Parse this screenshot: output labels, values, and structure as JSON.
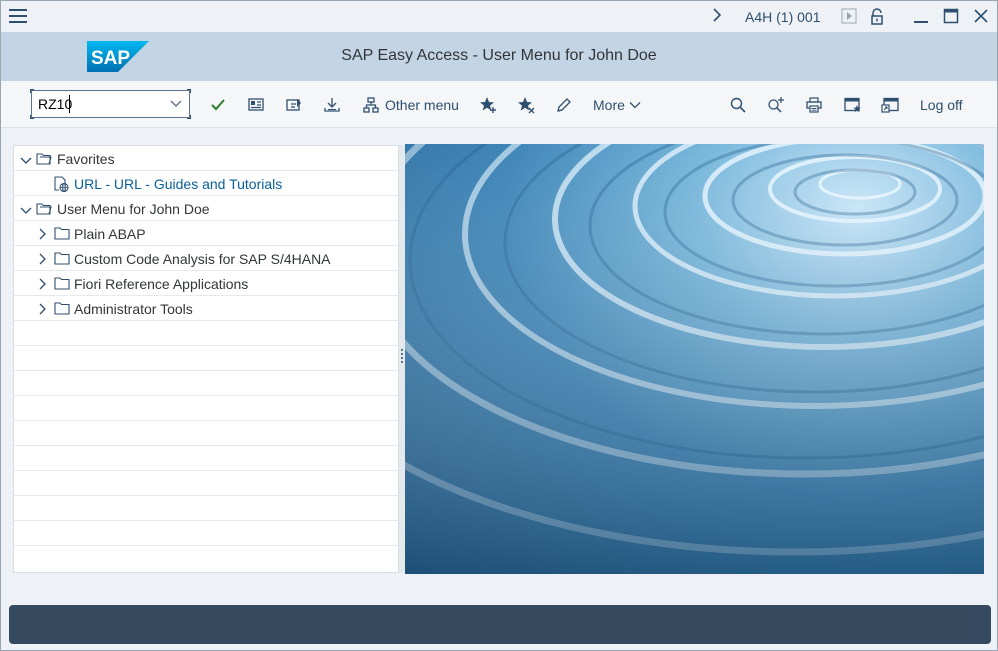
{
  "topbar": {
    "menu_icon": "hamburger-icon",
    "system_info": "A4H (1) 001",
    "icons": [
      "chevron-right-icon",
      "play-icon",
      "unlock-icon",
      "minimize-icon",
      "maximize-icon",
      "close-icon"
    ]
  },
  "header": {
    "logo_text": "SAP",
    "title": "SAP Easy Access  -  User Menu for John Doe",
    "brand_color": "#008fd3"
  },
  "toolbar": {
    "command_field": {
      "value": "RZ10"
    },
    "buttons": {
      "enter": "checkmark-icon",
      "other_menu": "Other menu",
      "more": "More",
      "log_off": "Log off"
    }
  },
  "tree": {
    "rows": [
      {
        "label": "Favorites",
        "type": "root",
        "expanded": true
      },
      {
        "label": "URL - URL - Guides and Tutorials",
        "type": "link"
      },
      {
        "label": "User Menu for John Doe",
        "type": "root",
        "expanded": true
      },
      {
        "label": "Plain ABAP",
        "type": "folder",
        "expanded": false
      },
      {
        "label": "Custom Code Analysis for SAP S/4HANA",
        "type": "folder",
        "expanded": false
      },
      {
        "label": "Fiori Reference Applications",
        "type": "folder",
        "expanded": false
      },
      {
        "label": "Administrator Tools",
        "type": "folder",
        "expanded": false
      }
    ]
  },
  "colors": {
    "header_bg": "#c3d4e4",
    "status_bar": "#354a5f",
    "link": "#0a5f99"
  }
}
